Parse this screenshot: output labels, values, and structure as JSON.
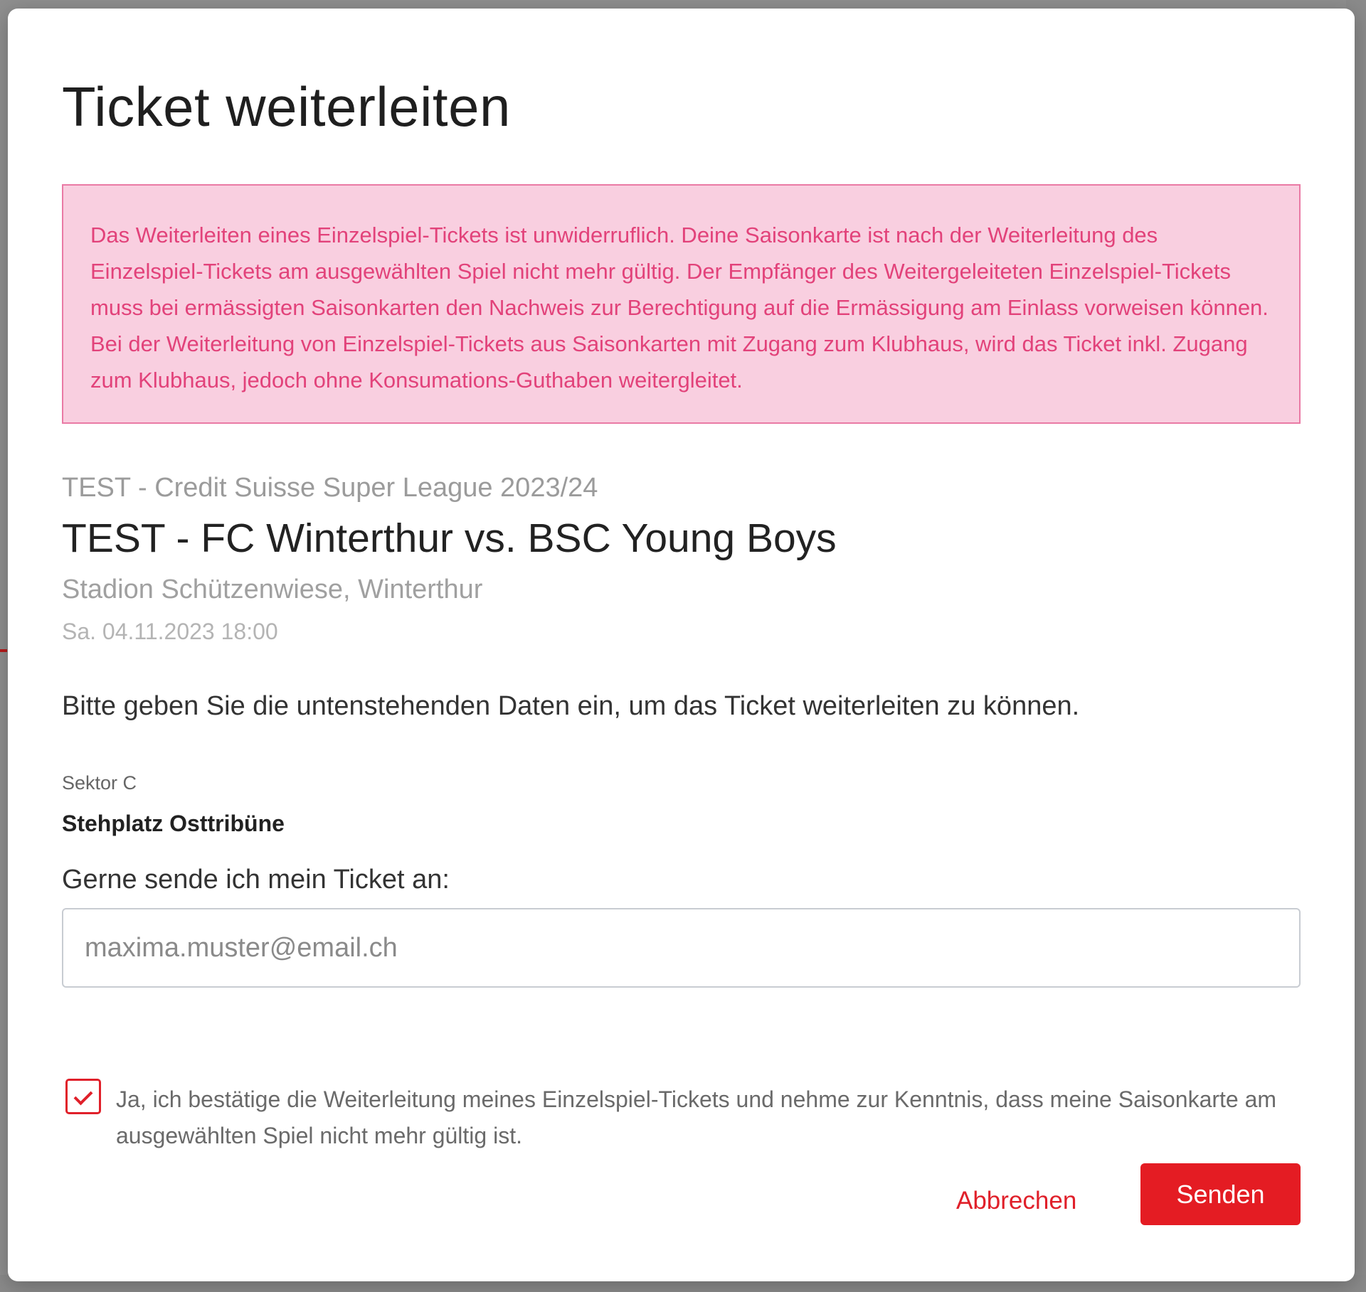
{
  "modal": {
    "title": "Ticket weiterleiten",
    "warning": "Das Weiterleiten eines Einzelspiel-Tickets ist unwiderruflich. Deine Saisonkarte ist nach der Weiterleitung des Einzelspiel-Tickets am ausgewählten Spiel nicht mehr gültig. Der Empfänger des Weitergeleiteten Einzelspiel-Tickets muss bei ermässigten Saisonkarten den Nachweis zur Berechtigung auf die Ermässigung am Einlass vorweisen können. Bei der Weiterleitung von Einzelspiel-Tickets aus Saisonkarten mit Zugang zum Klubhaus, wird das Ticket inkl. Zugang zum Klubhaus, jedoch ohne Konsumations-Guthaben weitergleitet."
  },
  "event": {
    "season": "TEST - Credit Suisse Super League 2023/24",
    "title": "TEST - FC Winterthur vs. BSC Young Boys",
    "venue": "Stadion Schützenwiese, Winterthur",
    "datetime": "Sa. 04.11.2023 18:00"
  },
  "form": {
    "instruction": "Bitte geben Sie die untenstehenden Daten ein, um das Ticket weiterleiten zu können.",
    "sector_label": "Sektor C",
    "sector_value": "Stehplatz Osttribüne",
    "recipient_label": "Gerne sende ich mein Ticket an:",
    "email_placeholder": "maxima.muster@email.ch",
    "email_value": "",
    "consent_checked": true,
    "consent_text": "Ja, ich bestätige die Weiterleitung meines Einzelspiel-Tickets und nehme zur Kenntnis, dass meine Saisonkarte am ausgewählten Spiel nicht mehr gültig ist."
  },
  "actions": {
    "cancel_label": "Abbrechen",
    "send_label": "Senden"
  },
  "colors": {
    "accent": "#e41c23",
    "warning_bg": "#f9cfe0",
    "warning_border": "#ea7aa5",
    "warning_text": "#e2427a"
  },
  "icons": {
    "checkbox_check": "check-icon"
  }
}
